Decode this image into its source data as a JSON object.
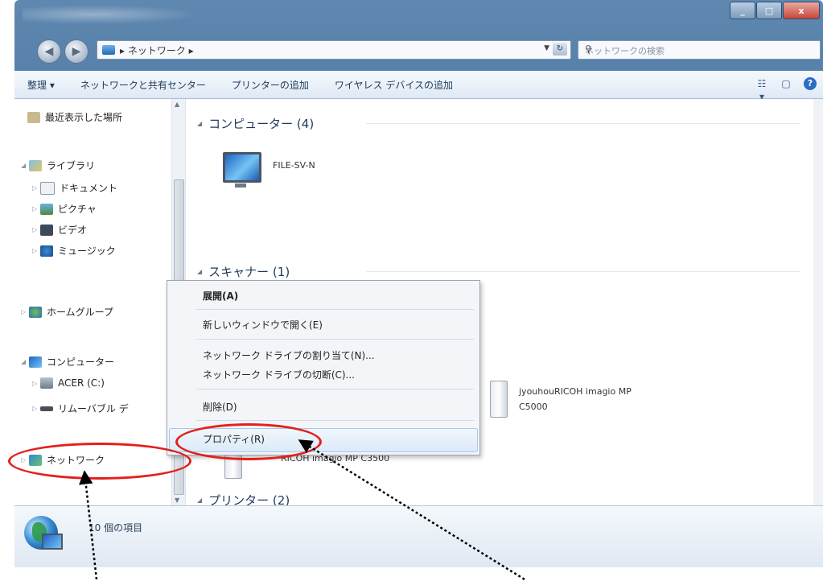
{
  "window": {
    "caption_buttons": [
      "_",
      "□",
      "x"
    ],
    "address": {
      "crumb": "▸ ネットワーク ▸"
    },
    "search": {
      "placeholder": "ネットワークの検索"
    }
  },
  "commands": [
    "整理 ▾",
    "ネットワークと共有センター",
    "プリンターの追加",
    "ワイヤレス デバイスの追加"
  ],
  "nav": {
    "recent": "最近表示した場所",
    "library": "ライブラリ",
    "documents": "ドキュメント",
    "pictures": "ピクチャ",
    "videos": "ビデオ",
    "music": "ミュージック",
    "homegroup": "ホームグループ",
    "computer": "コンピューター",
    "acer": "ACER (C:)",
    "removable": "リムーバブル デ",
    "network": "ネットワーク"
  },
  "groups": {
    "computers": "コンピューター (4)",
    "scanners": "スキャナー (1)",
    "printers": "プリンター (2)"
  },
  "items": {
    "file_server": "FILE-SV-N",
    "printer1_line1": "jyouhouRICOH imagio MP",
    "printer1_line2": "C5000",
    "printer2": "RICOH imagio MP C3500"
  },
  "context_menu": {
    "expand": "展開(A)",
    "open_new_window": "新しいウィンドウで開く(E)",
    "map_drive": "ネットワーク ドライブの割り当て(N)...",
    "disconnect_drive": "ネットワーク ドライブの切断(C)...",
    "delete": "削除(D)",
    "properties": "プロパティ(R)"
  },
  "status": {
    "count": "10 個の項目"
  }
}
